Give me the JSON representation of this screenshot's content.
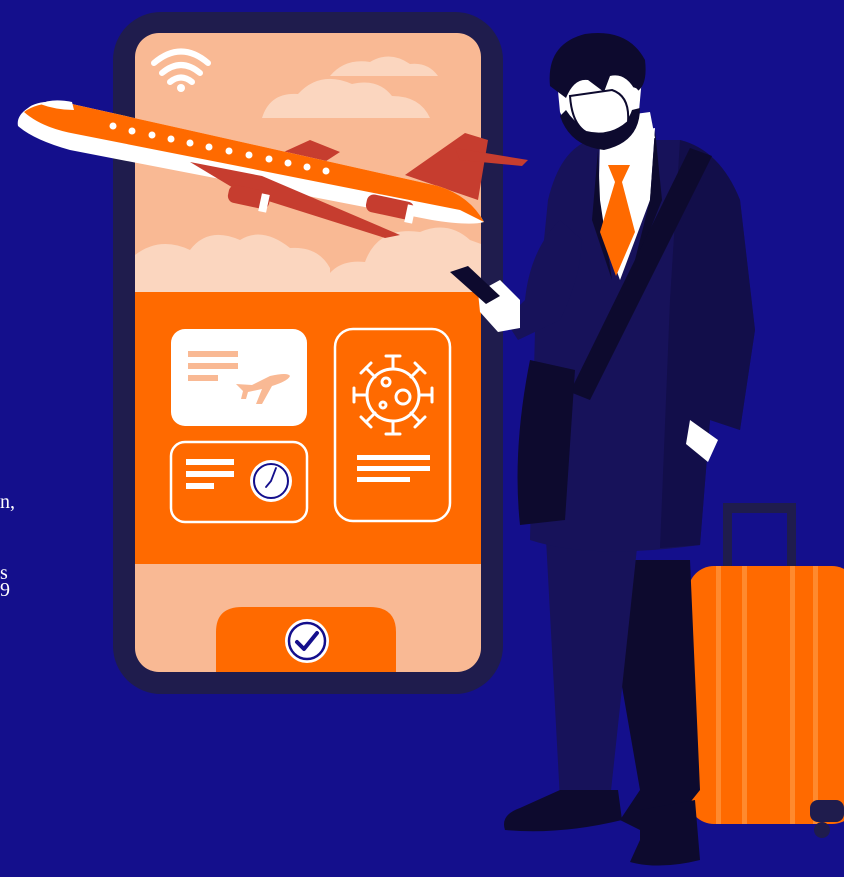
{
  "edge_text": {
    "line_1": "n,",
    "line_2": "s",
    "line_3": "9"
  },
  "colors": {
    "background": "#140f8c",
    "phone_frame": "#1f1c4d",
    "screen_peach": "#f9b994",
    "screen_cloud": "#fbd6bf",
    "accent_orange": "#ff6a00",
    "plane_red": "#c63d2f",
    "suit_navy": "#17125a",
    "suit_dark": "#0d0a2e",
    "white": "#ffffff"
  },
  "icons": {
    "wifi": "wifi-icon",
    "boarding_pass": "boarding-pass-icon",
    "clock": "clock-icon",
    "virus": "virus-icon",
    "check": "check-circle-icon",
    "airplane": "airplane-icon"
  }
}
